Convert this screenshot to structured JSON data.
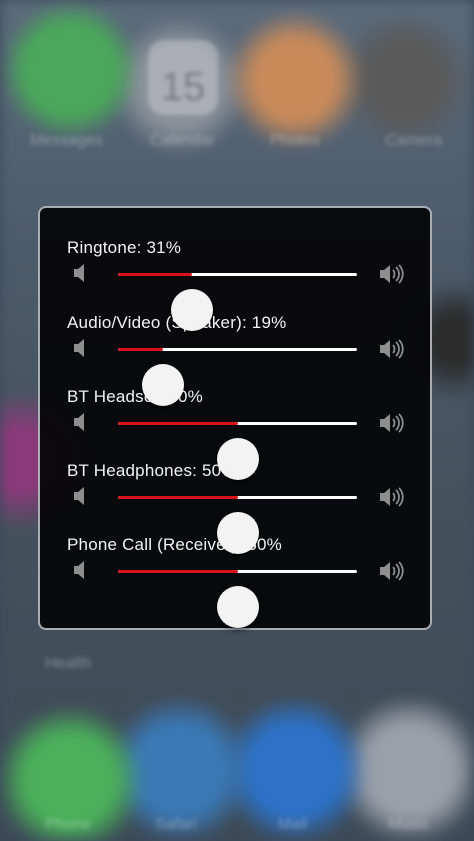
{
  "background": {
    "labels": [
      "Messages",
      "Calendar",
      "Photos",
      "Camera",
      "Health",
      "Phone",
      "Safari",
      "Mail",
      "Music"
    ],
    "calendar_date": "15"
  },
  "panel": {
    "sliders": [
      {
        "label": "Ringtone: 31%",
        "value": 0.31
      },
      {
        "label": "Audio/Video (Speaker): 19%",
        "value": 0.19
      },
      {
        "label": "BT Headset: 50%",
        "value": 0.5
      },
      {
        "label": "BT Headphones: 50%",
        "value": 0.5
      },
      {
        "label": "Phone Call (Receiver): 50%",
        "value": 0.5
      }
    ],
    "colors": {
      "fill": "#d9141c",
      "track": "#ffffff",
      "thumb": "#f3f3f3"
    },
    "icons": {
      "low": "speaker-low-icon",
      "high": "speaker-high-icon"
    }
  }
}
